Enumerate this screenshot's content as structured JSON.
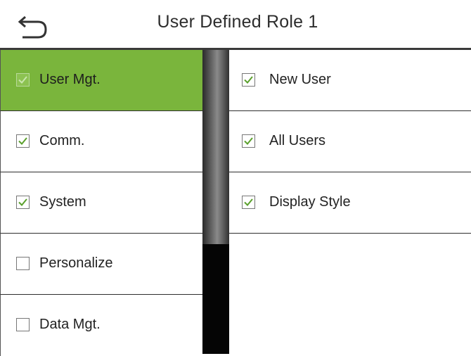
{
  "header": {
    "title": "User Defined Role 1",
    "back_icon": "back-arrow-icon"
  },
  "left_menu": [
    {
      "label": "User Mgt.",
      "checked": true,
      "selected": true
    },
    {
      "label": "Comm.",
      "checked": true,
      "selected": false
    },
    {
      "label": "System",
      "checked": true,
      "selected": false
    },
    {
      "label": "Personalize",
      "checked": false,
      "selected": false
    },
    {
      "label": "Data Mgt.",
      "checked": false,
      "selected": false
    }
  ],
  "right_menu": [
    {
      "label": "New User",
      "checked": true
    },
    {
      "label": "All Users",
      "checked": true
    },
    {
      "label": "Display Style",
      "checked": true
    }
  ],
  "colors": {
    "selected_bg": "#7ab53c",
    "check_color": "#5aa02c"
  }
}
